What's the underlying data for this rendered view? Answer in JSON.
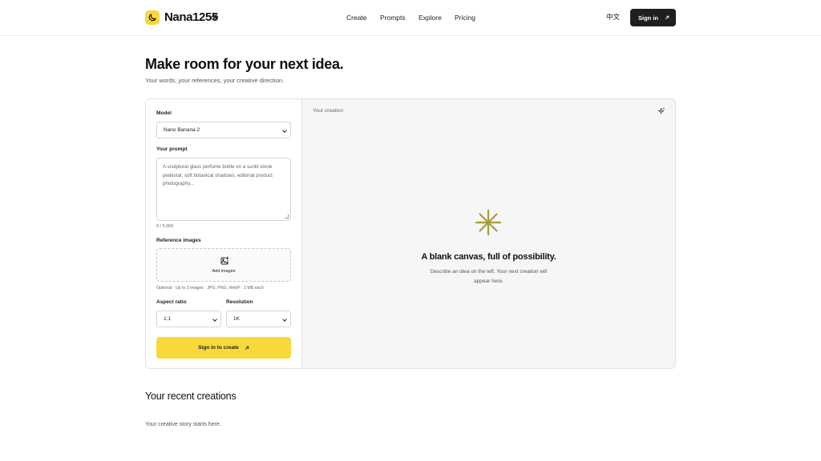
{
  "brand": {
    "name": "Nana1255",
    "accent": "#f7d93c",
    "logo_icon": "moon-icon",
    "badge_icon": "sparkle-icon"
  },
  "nav": {
    "links": [
      "Create",
      "Prompts",
      "Explore",
      "Pricing"
    ],
    "language": "中文",
    "signin_label": "Sign in",
    "signin_icon": "arrow-up-right-icon"
  },
  "hero": {
    "title": "Make room for your next idea.",
    "subtitle": "Your words, your references, your creative direction."
  },
  "form": {
    "model_label": "Model",
    "model_value": "Nano Banana 2",
    "prompt_label": "Your prompt",
    "prompt_placeholder": "A sculptural glass perfume bottle on a sunlit stone pedestal, soft botanical shadows, editorial product photography...",
    "prompt_counter": "0 / 5,000",
    "ref_label": "Reference images",
    "ref_add_label": "Add images",
    "ref_add_icon": "image-plus-icon",
    "ref_note": "Optional · Up to 3 images · JPG, PNG, WebP · 2 MB each",
    "aspect_label": "Aspect ratio",
    "aspect_value": "1:1",
    "resolution_label": "Resolution",
    "resolution_value": "1K",
    "submit_label": "Sign in to create",
    "submit_icon": "arrow-up-right-icon"
  },
  "canvas": {
    "label": "Your creation",
    "empty_icon": "asterisk-icon",
    "empty_title": "A blank canvas, full of possibility.",
    "empty_desc": "Describe an idea on the left. Your next creation will appear here."
  },
  "recent": {
    "title": "Your recent creations",
    "subtitle": "Your creative story starts here."
  }
}
